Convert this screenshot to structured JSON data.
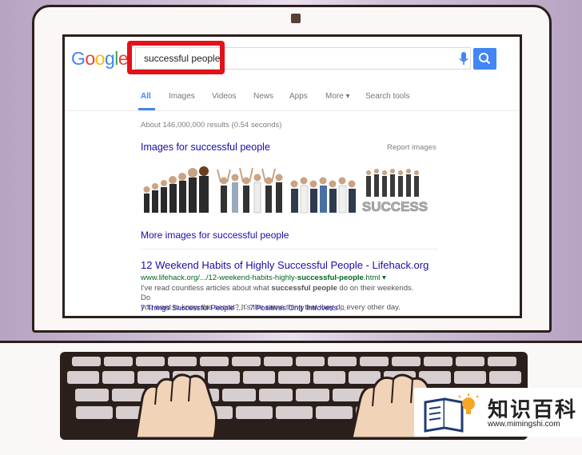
{
  "google": {
    "logo_letters": [
      {
        "ch": "G",
        "color": "#4285f4"
      },
      {
        "ch": "o",
        "color": "#ea4335"
      },
      {
        "ch": "o",
        "color": "#fbbc05"
      },
      {
        "ch": "g",
        "color": "#4285f4"
      },
      {
        "ch": "l",
        "color": "#34a853"
      },
      {
        "ch": "e",
        "color": "#ea4335"
      }
    ],
    "search_query": "successful people",
    "tabs": [
      "All",
      "Images",
      "Videos",
      "News",
      "Apps",
      "More ▾",
      "Search tools"
    ],
    "results_count": "About 146,000,000 results (0.54 seconds)",
    "images_header": "Images for successful people",
    "report_images": "Report images",
    "more_images": "More images for successful people",
    "success_image_text": "SUCCESS",
    "result": {
      "title": "12 Weekend Habits of Highly Successful People - Lifehack.org",
      "url_prefix": "www.lifehack.org/.../12-weekend-habits-highly-",
      "url_bold": "successful-people",
      "url_suffix": ".html ▾",
      "snippet_line1_a": "I've read countless articles about what ",
      "snippet_bold1": "successful people",
      "snippet_line1_b": " do on their weekends. Do",
      "snippet_line2": "you want to know the secret? It's the same thing that they do every other day.",
      "sublink1": "7 Things Successful People ...",
      "sublink_sep": " · ",
      "sublink2": "7 Positives Only Introverts ..."
    }
  },
  "watermark": {
    "title": "知识百科",
    "url": "www.mimingshi.com"
  },
  "colors": {
    "google_blue": "#4285f4",
    "link_blue": "#1a0dab",
    "url_green": "#006621",
    "highlight_red": "#e3111a"
  }
}
